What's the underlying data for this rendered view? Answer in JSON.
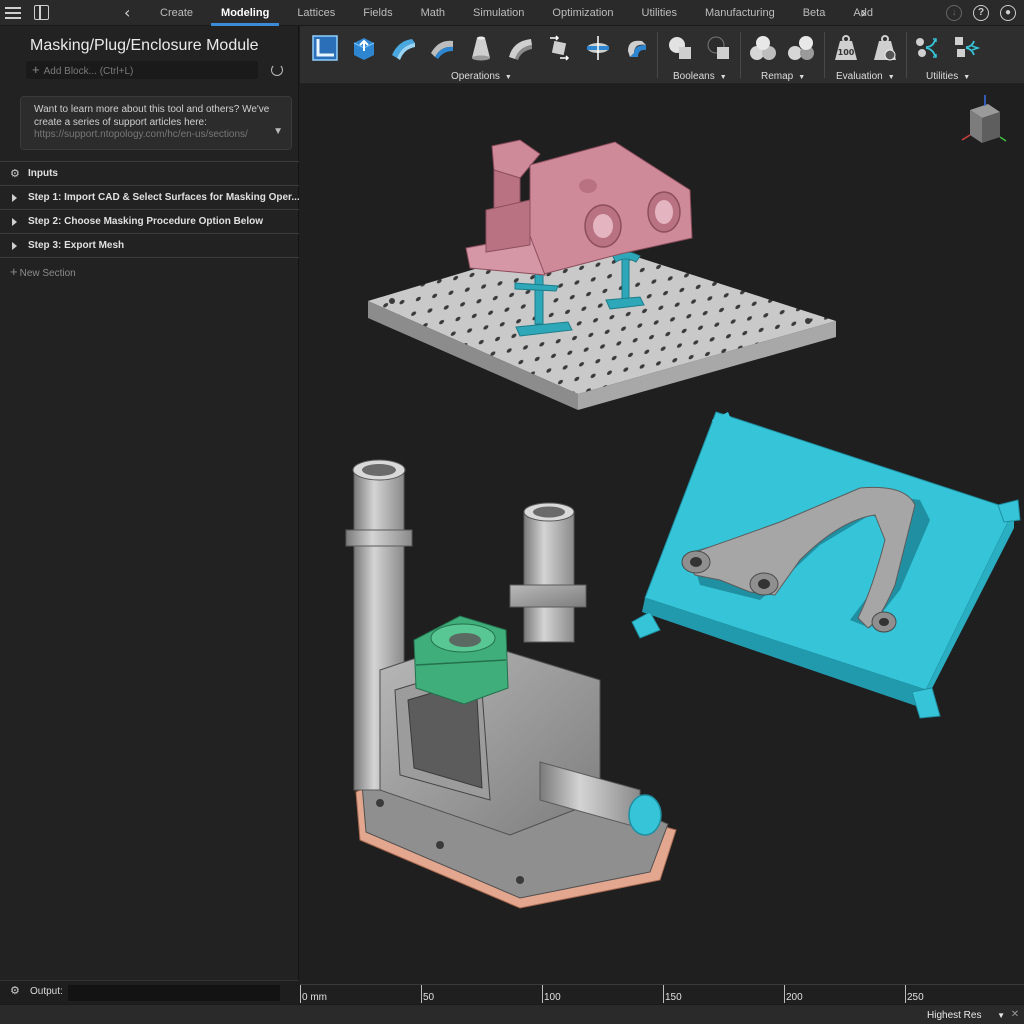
{
  "nav": {
    "tabs": [
      {
        "label": "Create",
        "active": false
      },
      {
        "label": "Modeling",
        "active": true
      },
      {
        "label": "Lattices",
        "active": false
      },
      {
        "label": "Fields",
        "active": false
      },
      {
        "label": "Math",
        "active": false
      },
      {
        "label": "Simulation",
        "active": false
      },
      {
        "label": "Optimization",
        "active": false
      },
      {
        "label": "Utilities",
        "active": false
      },
      {
        "label": "Manufacturing",
        "active": false
      },
      {
        "label": "Beta",
        "active": false
      },
      {
        "label": "Additive",
        "active": false
      }
    ],
    "accent": "#3b8bd8"
  },
  "panel": {
    "title": "Masking/Plug/Enclosure Module",
    "add_block_placeholder": "Add Block... (Ctrl+L)",
    "info_text": "Want to learn more about this tool and others? We've create a series of support articles here:",
    "info_link": "https://support.ntopology.com/hc/en-us/sections/",
    "sections": [
      {
        "label": "Inputs",
        "icon": "gear-icon"
      },
      {
        "label": "Step 1: Import CAD & Select Surfaces for Masking Oper...",
        "icon": "triangle-icon"
      },
      {
        "label": "Step 2: Choose Masking Procedure Option Below",
        "icon": "triangle-icon"
      },
      {
        "label": "Step 3: Export Mesh",
        "icon": "triangle-icon"
      }
    ],
    "new_section": "New Section",
    "output_label": "Output:"
  },
  "ribbon": {
    "groups": {
      "operations": "Operations",
      "booleans": "Booleans",
      "remap": "Remap",
      "evaluation": "Evaluation",
      "utilities": "Utilities"
    },
    "badge": "100"
  },
  "viewport": {
    "ruler_labels": [
      "0 mm",
      "50",
      "100",
      "150",
      "200",
      "250"
    ],
    "colors": {
      "part_pink": "#cf8a9a",
      "support_teal": "#2ea8b8",
      "mold_cyan": "#35c4d8",
      "plug_green": "#3fae7a",
      "base_copper": "#e2a78e",
      "metal_gray": "#9a9a9a"
    }
  },
  "status": {
    "resolution": "Highest Res"
  }
}
